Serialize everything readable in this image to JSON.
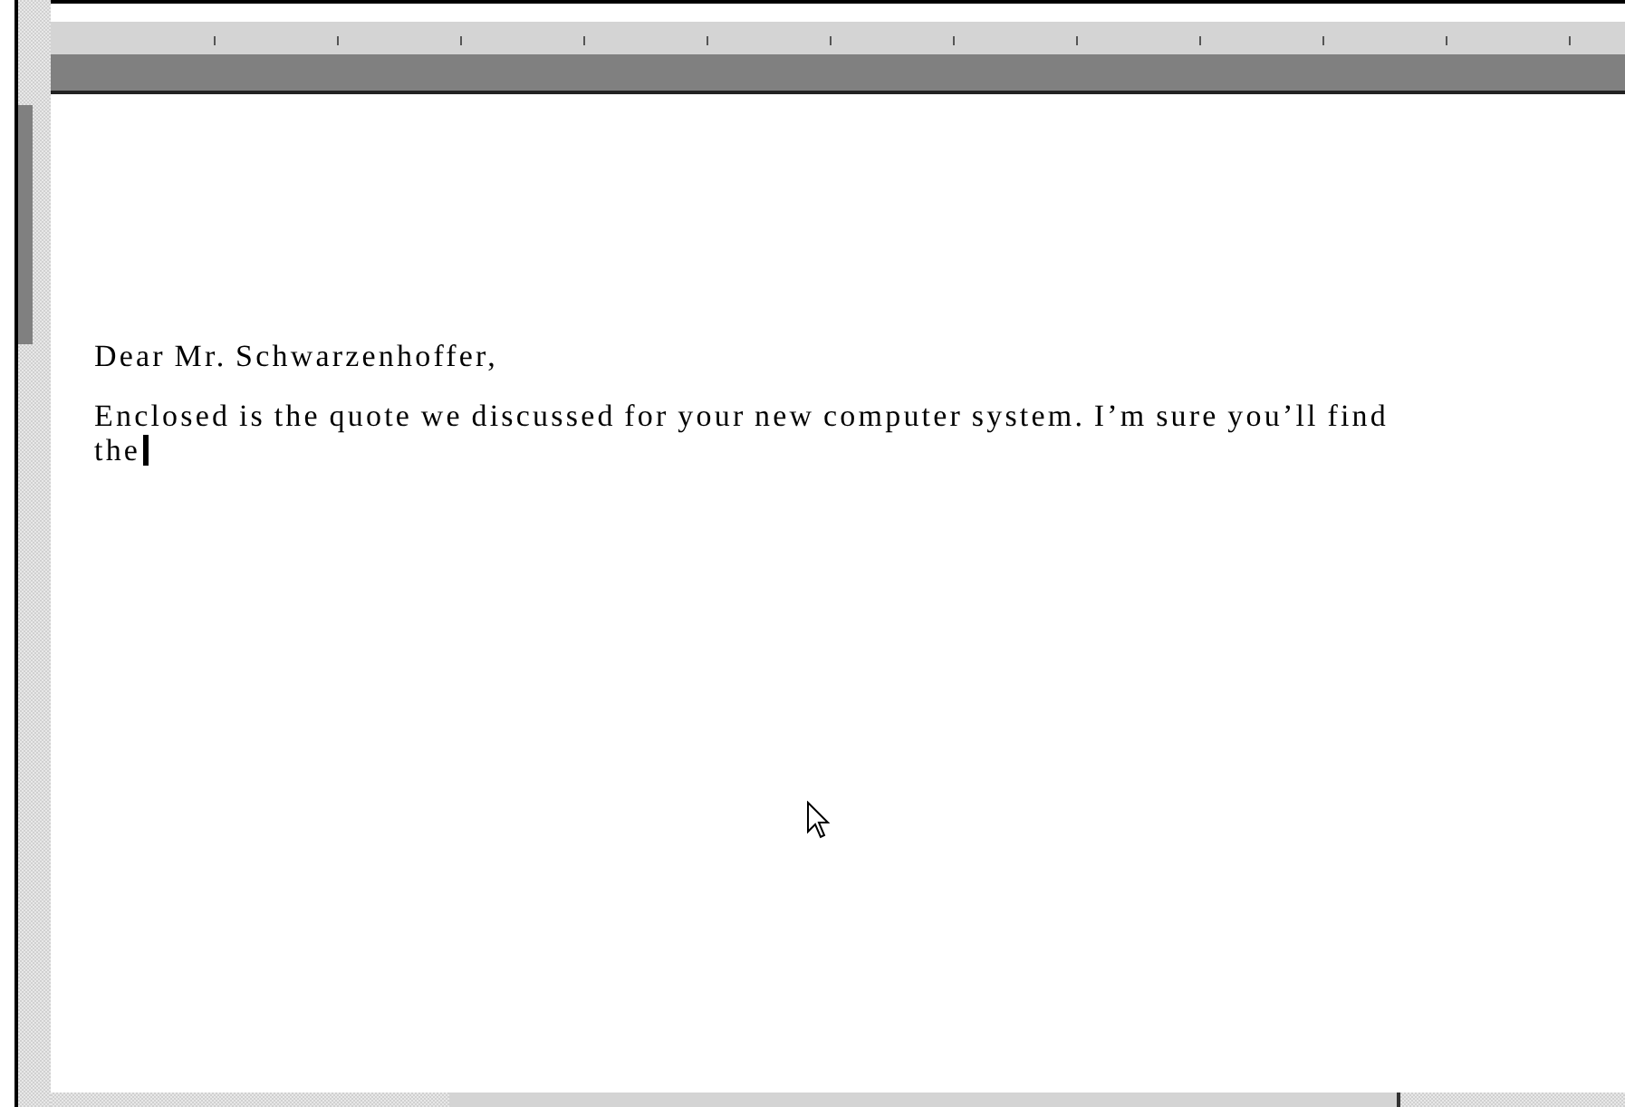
{
  "document": {
    "paragraphs": [
      {
        "lines": [
          "Dear Mr. Schwarzenhoffer,"
        ]
      },
      {
        "lines": [
          "Enclosed is the quote we discussed for your new computer system. I’m sure you’ll find",
          "the"
        ],
        "caret": true
      }
    ]
  }
}
